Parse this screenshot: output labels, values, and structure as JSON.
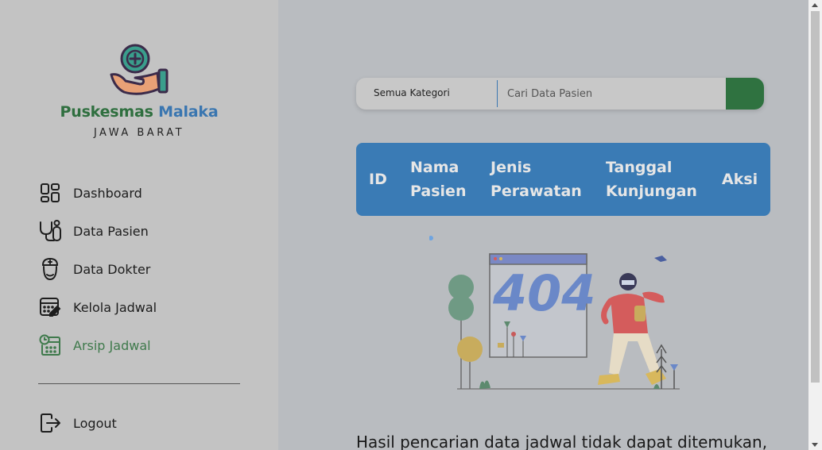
{
  "brand": {
    "name_part1": "Puskesmas",
    "name_part2": "Malaka",
    "subtitle": "JAWA BARAT",
    "logo_icon": "hand-plus-icon"
  },
  "sidebar": {
    "items": [
      {
        "label": "Dashboard",
        "icon": "dashboard-icon",
        "active": false
      },
      {
        "label": "Data Pasien",
        "icon": "stethoscope-icon",
        "active": false
      },
      {
        "label": "Data Dokter",
        "icon": "doctor-icon",
        "active": false
      },
      {
        "label": "Kelola Jadwal",
        "icon": "calendar-edit-icon",
        "active": false
      },
      {
        "label": "Arsip Jadwal",
        "icon": "calendar-clock-icon",
        "active": true
      }
    ],
    "logout_label": "Logout"
  },
  "search": {
    "category": "Semua Kategori",
    "placeholder": "Cari Data Pasien",
    "value": ""
  },
  "table": {
    "headers": [
      "ID",
      "Nama Pasien",
      "Jenis Perawatan",
      "Tanggal Kunjungan",
      "Aksi"
    ],
    "header_lines": {
      "id": "ID",
      "nama_1": "Nama",
      "nama_2": "Pasien",
      "jenis_1": "Jenis",
      "jenis_2": "Perawatan",
      "tanggal_1": "Tanggal",
      "tanggal_2": "Kunjungan",
      "aksi": "Aksi"
    }
  },
  "illustration": {
    "text": "404"
  },
  "message": "Hasil pencarian data jadwal tidak dapat ditemukan,",
  "colors": {
    "primary_green": "#2f7240",
    "primary_blue": "#3a7bb5",
    "sidebar_bg": "#c3c3c3",
    "main_bg": "#b9bcc0"
  }
}
